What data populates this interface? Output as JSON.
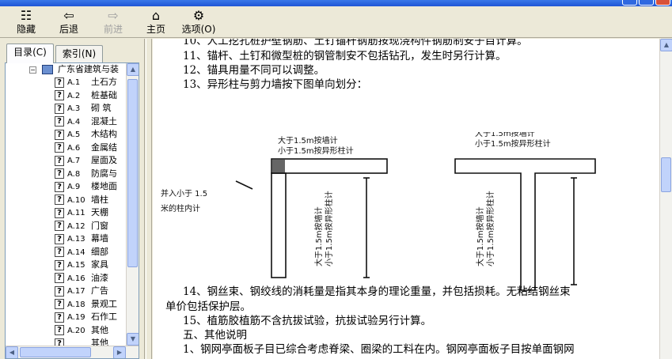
{
  "toolbar": {
    "hide": "隐藏",
    "back": "后退",
    "forward": "前进",
    "home": "主页",
    "options": "选项(O)"
  },
  "tabs": [
    {
      "label": "目录(C)",
      "active": true
    },
    {
      "label": "索引(N)",
      "active": false
    }
  ],
  "tree": {
    "root": "广东省建筑与装",
    "items": [
      {
        "code": "A.1",
        "label": "土石方"
      },
      {
        "code": "A.2",
        "label": "桩基础"
      },
      {
        "code": "A.3",
        "label": "砌 筑"
      },
      {
        "code": "A.4",
        "label": "混凝土"
      },
      {
        "code": "A.5",
        "label": "木结构"
      },
      {
        "code": "A.6",
        "label": "金属结"
      },
      {
        "code": "A.7",
        "label": "屋面及"
      },
      {
        "code": "A.8",
        "label": "防腐与"
      },
      {
        "code": "A.9",
        "label": "楼地面"
      },
      {
        "code": "A.10",
        "label": "墙柱"
      },
      {
        "code": "A.11",
        "label": "天棚"
      },
      {
        "code": "A.12",
        "label": "门窗"
      },
      {
        "code": "A.13",
        "label": "幕墙"
      },
      {
        "code": "A.14",
        "label": "细部"
      },
      {
        "code": "A.15",
        "label": "家具"
      },
      {
        "code": "A.16",
        "label": "油漆"
      },
      {
        "code": "A.17",
        "label": "广告"
      },
      {
        "code": "A.18",
        "label": "景观工"
      },
      {
        "code": "A.19",
        "label": "石作工"
      },
      {
        "code": "A.20",
        "label": "其他"
      },
      {
        "code": "",
        "label": "其他"
      }
    ]
  },
  "content": {
    "lines": [
      "10、人工挖孔桩护壁钢筋、土钉锚杆钢筋按现浇构件钢筋制安子目计算。",
      "11、锚杆、土钉和微型桩的钢管制安不包括钻孔，发生时另行计算。",
      "12、锚具用量不同可以调整。",
      "13、异形柱与剪力墙按下图单向划分：",
      "14、钢丝束、钢绞线的消耗量是指其本身的理论重量，并包括损耗。无粘结钢丝束",
      "单价包括保护层。",
      "15、植筋胶植筋不含抗拔试验，抗拔试验另行计算。",
      "五、其他说明",
      "1、钢网亭面板子目已综合考虑脊梁、圈梁的工料在内。钢网亭面板子目按单面钢网"
    ],
    "diagram": {
      "note_left_line1": "并入小于 1.5",
      "note_left_line2": "米的柱内计",
      "top_label_1": "大于1.5m按墙计",
      "top_label_2": "小于1.5m按异形柱计",
      "side_label_1": "大于1.5m按墙计",
      "side_label_2": "小于1.5m按异形柱计"
    }
  }
}
